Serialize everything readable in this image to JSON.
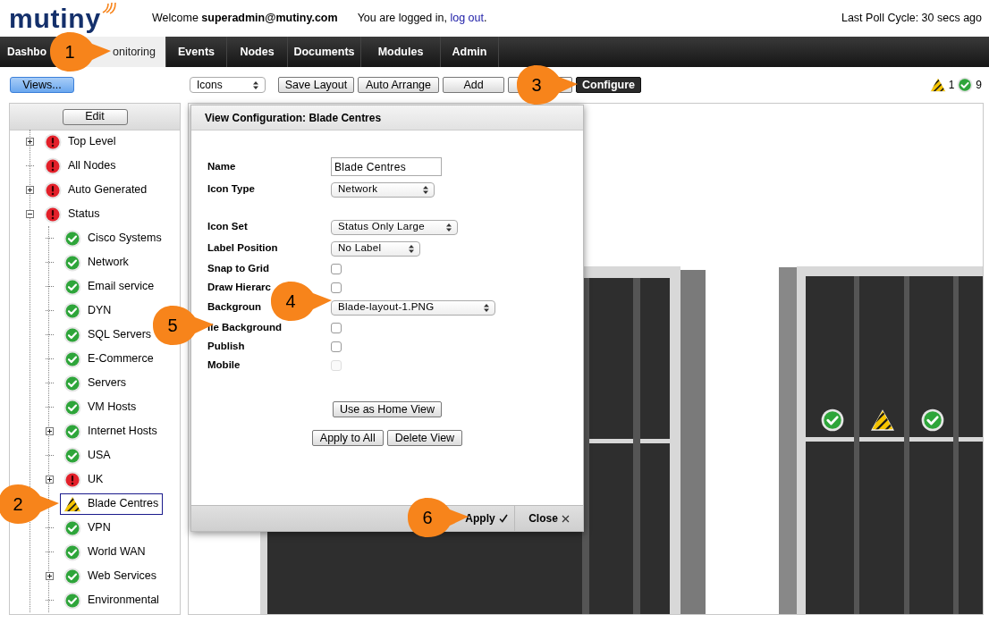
{
  "header": {
    "logo": "mutiny",
    "welcome": "Welcome",
    "user": "superadmin@mutiny.com",
    "login_text": "You are logged in,",
    "logout_link": "log out",
    "login_end": ".",
    "last_poll": "Last Poll Cycle: 30 secs ago"
  },
  "nav_tabs": [
    {
      "label": "Dashbo",
      "selected": false
    },
    {
      "label": "onitoring",
      "selected": true
    },
    {
      "label": "Events",
      "selected": false
    },
    {
      "label": "Nodes",
      "selected": false
    },
    {
      "label": "Documents",
      "selected": false
    },
    {
      "label": "Modules",
      "selected": false
    },
    {
      "label": "Admin",
      "selected": false
    }
  ],
  "toolbar": {
    "views_button": "Views...",
    "mode_select": "Icons",
    "buttons": [
      {
        "kind": "normal",
        "label": "Save Layout"
      },
      {
        "kind": "normal",
        "label": "Auto Arrange"
      },
      {
        "kind": "normal",
        "label": "Add"
      },
      {
        "kind": "covered"
      },
      {
        "kind": "active",
        "label": "Configure"
      }
    ],
    "status_counts": [
      {
        "kind": "warning",
        "count": "1"
      },
      {
        "kind": "ok",
        "count": "9"
      }
    ]
  },
  "sidebar": {
    "edit_button": "Edit",
    "tree": [
      {
        "label": "Top Level",
        "kind": "error",
        "expandable": true,
        "expanded": false,
        "selected": false
      },
      {
        "label": "All Nodes",
        "kind": "error",
        "expandable": false,
        "selected": false
      },
      {
        "label": "Auto Generated",
        "kind": "error",
        "expandable": true,
        "expanded": false,
        "selected": false
      },
      {
        "label": "Status",
        "kind": "error",
        "expandable": true,
        "expanded": true,
        "selected": false,
        "children": [
          {
            "label": "Cisco Systems",
            "kind": "ok",
            "expandable": false,
            "selected": false
          },
          {
            "label": "Network",
            "kind": "ok",
            "expandable": false,
            "selected": false
          },
          {
            "label": "Email service",
            "kind": "ok",
            "expandable": false,
            "selected": false
          },
          {
            "label": "DYN",
            "kind": "ok",
            "expandable": false,
            "selected": false
          },
          {
            "label": "SQL Servers",
            "kind": "ok",
            "expandable": false,
            "selected": false
          },
          {
            "label": "E-Commerce",
            "kind": "ok",
            "expandable": false,
            "selected": false
          },
          {
            "label": "Servers",
            "kind": "ok",
            "expandable": false,
            "selected": false
          },
          {
            "label": "VM Hosts",
            "kind": "ok",
            "expandable": false,
            "selected": false
          },
          {
            "label": "Internet Hosts",
            "kind": "ok",
            "expandable": true,
            "expanded": false,
            "selected": false
          },
          {
            "label": "USA",
            "kind": "ok",
            "expandable": false,
            "selected": false
          },
          {
            "label": "UK",
            "kind": "error",
            "expandable": true,
            "expanded": false,
            "selected": false
          },
          {
            "label": "Blade Centres",
            "kind": "warning",
            "expandable": false,
            "selected": true
          },
          {
            "label": "VPN",
            "kind": "ok",
            "expandable": false,
            "selected": false
          },
          {
            "label": "World WAN",
            "kind": "ok",
            "expandable": false,
            "selected": false
          },
          {
            "label": "Web Services",
            "kind": "ok",
            "expandable": true,
            "expanded": false,
            "selected": false
          },
          {
            "label": "Environmental",
            "kind": "ok",
            "expandable": false,
            "selected": false
          }
        ]
      }
    ]
  },
  "canvas": {
    "node_icons": [
      {
        "kind": "ok"
      },
      {
        "kind": "warning"
      },
      {
        "kind": "ok"
      }
    ]
  },
  "dialog": {
    "title": "View Configuration: Blade Centres",
    "fields": [
      {
        "kind": "text",
        "label": "Name",
        "value": "Blade Centres"
      },
      {
        "kind": "select",
        "label": "Icon Type",
        "value": "Network"
      },
      {
        "kind": "select",
        "label": "Icon Set",
        "value": "Status Only Large"
      },
      {
        "kind": "select",
        "label": "Label Position",
        "value": "No Label"
      },
      {
        "kind": "checkbox",
        "label": "Snap to Grid",
        "checked": false,
        "disabled": false
      },
      {
        "kind": "checkbox",
        "label": "Draw Hierarc",
        "checked": false,
        "disabled": false
      },
      {
        "kind": "select",
        "label": "Backgroun",
        "value": "Blade-layout-1.PNG"
      },
      {
        "kind": "checkbox",
        "label": "ile Background",
        "checked": false,
        "disabled": false
      },
      {
        "kind": "checkbox",
        "label": "Publish",
        "checked": false,
        "disabled": false
      },
      {
        "kind": "checkbox",
        "label": "Mobile",
        "checked": false,
        "disabled": true
      }
    ],
    "home_button": "Use as Home View",
    "action_buttons": [
      "Apply to All",
      "Delete View"
    ],
    "apply_button": "Apply",
    "close_button": "Close"
  },
  "callouts": [
    "1",
    "2",
    "3",
    "4",
    "5",
    "6"
  ]
}
